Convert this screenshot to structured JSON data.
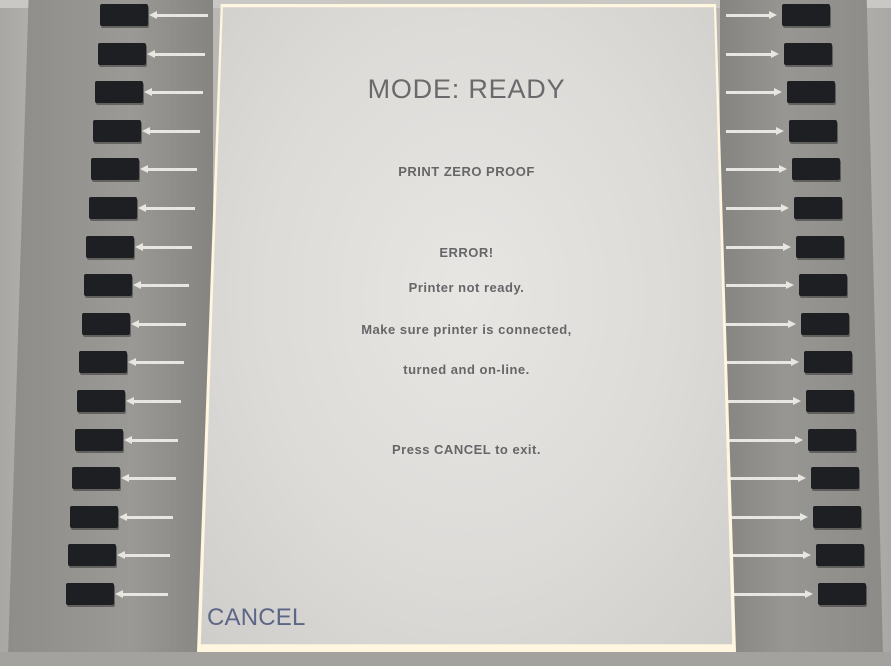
{
  "screen": {
    "mode_title": "MODE: READY",
    "function_title": "PRINT ZERO PROOF",
    "message": {
      "error_heading": "ERROR!",
      "line1": "Printer not ready.",
      "line2": "Make sure printer is connected,",
      "line3": "turned and on-line.",
      "instruction": "Press CANCEL to exit."
    },
    "softkey_label_bottom_left": "CANCEL"
  },
  "device": {
    "left_softkeys_count": 16,
    "right_softkeys_count": 16,
    "screen_background": "#dddbd8",
    "text_color": "#666668",
    "cancel_label_color": "#5d6686"
  }
}
